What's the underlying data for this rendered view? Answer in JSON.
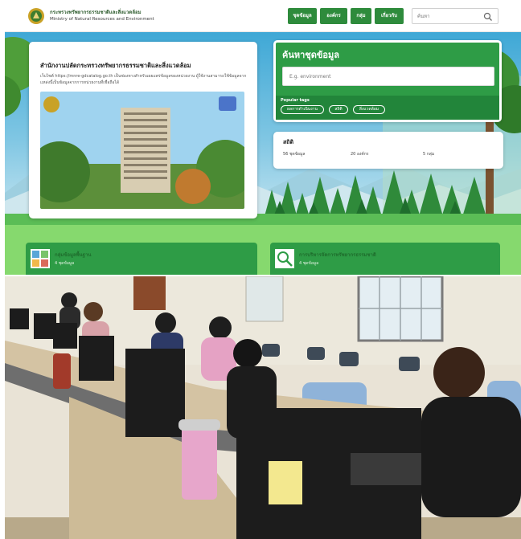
{
  "nav": {
    "org_name_thai": "กระทรวงทรัพยากรธรรมชาติและสิ่งแวดล้อม",
    "org_name_en": "Ministry of Natural Resources and Environment",
    "buttons": [
      "ชุดข้อมูล",
      "องค์กร",
      "กลุ่ม",
      "เกี่ยวกับ"
    ],
    "search_placeholder": "ค้นหา",
    "search_icon": "magnifier-icon"
  },
  "info_card": {
    "title": "สำนักงานปลัดกระทรวงทรัพยากรธรรมชาติและสิ่งแวดล้อม",
    "description": "เว็บไซต์ https://mnre-gdcatalog.go.th เป็นช่องทางสำหรับเผยแพร่ข้อมูลของหน่วยงาน ผู้ใช้งานสามารถใช้ข้อมูลจากแหล่งนี้เป็นข้อมูลจากการหน่วยงานที่เชื่อถือได้"
  },
  "search_card": {
    "title": "ค้นหาชุดข้อมูล",
    "placeholder": "E.g. environment",
    "popular_label": "Popular tags",
    "tags": [
      "ผลการดำเนินงาน",
      "สถิติ",
      "สิ่งแวดล้อม"
    ]
  },
  "stats": {
    "heading": "สถิติ",
    "items": [
      "56 ชุดข้อมูล",
      "20 องค์กร",
      "5 กลุ่ม"
    ]
  },
  "organizations": [
    {
      "name": "กลุ่มข้อมูลพื้นฐาน",
      "count": "4 ชุดข้อมูล"
    },
    {
      "name": "การบริหารจัดการทรัพยากรธรรมชาติ",
      "count": "4 ชุดข้อมูล"
    }
  ],
  "colors": {
    "brand_green": "#2e9c46",
    "dark_green": "#22853a",
    "band_green": "#86d96e",
    "sky_blue": "#3fa8d6"
  }
}
